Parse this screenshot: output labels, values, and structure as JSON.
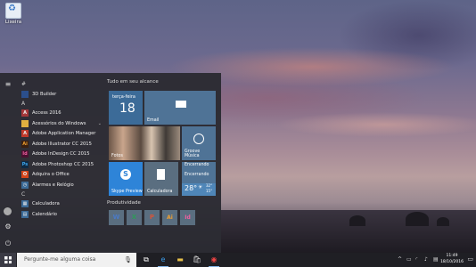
{
  "desktop": {
    "recycle_bin_label": "Lixeira"
  },
  "start_menu": {
    "rail": {
      "hamburger_icon": "hamburger-icon",
      "settings_icon": "gear-icon",
      "power_icon": "power-icon"
    },
    "sections": [
      {
        "letter": "#",
        "apps": [
          {
            "label": "3D Builder",
            "color": "#2b4f8c",
            "glyph": "3D"
          }
        ]
      },
      {
        "letter": "A",
        "apps": [
          {
            "label": "Access 2016",
            "color": "#a4373a",
            "glyph": "A"
          },
          {
            "label": "Acessórios do Windows",
            "color": "#e0b040",
            "glyph": "▬",
            "expand": "⌄"
          },
          {
            "label": "Adobe Application Manager",
            "color": "#c0392b",
            "glyph": "A"
          },
          {
            "label": "Adobe Illustrator CC 2015",
            "color": "#3a2010",
            "glyph": "Ai"
          },
          {
            "label": "Adobe InDesign CC 2015",
            "color": "#4a1030",
            "glyph": "Id"
          },
          {
            "label": "Adobe Photoshop CC 2015",
            "color": "#0f2a44",
            "glyph": "Ps"
          },
          {
            "label": "Adquira o Office",
            "color": "#d4451a",
            "glyph": "O"
          },
          {
            "label": "Alarmes e Relógio",
            "color": "#3c6b98",
            "glyph": "◷"
          }
        ]
      },
      {
        "letter": "C",
        "apps": [
          {
            "label": "Calculadora",
            "color": "#3c6b98",
            "glyph": "▦"
          },
          {
            "label": "Calendário",
            "color": "#3c6b98",
            "glyph": "▤"
          }
        ]
      }
    ],
    "tiles": {
      "group1_title": "Tudo em seu alcance",
      "calendar": {
        "day_name": "terça-feira",
        "day_number": "18"
      },
      "mail": {
        "label": "Email"
      },
      "photos": {
        "label": "Fotos"
      },
      "groove": {
        "label": "Groove Música"
      },
      "news": {
        "line1": "Encerrando",
        "line2": "Encerrando"
      },
      "skype": {
        "label": "Skype Preview"
      },
      "calculator": {
        "label": "Calculadora"
      },
      "weather": {
        "temp": "28°",
        "hi": "32°",
        "lo": "15°"
      },
      "group2_title": "Produtividade",
      "productivity": [
        {
          "glyph": "W",
          "color": "#2b579a"
        },
        {
          "glyph": "X",
          "color": "#217346"
        },
        {
          "glyph": "P",
          "color": "#b7472a"
        },
        {
          "glyph": "Ai",
          "color": "#3a2010"
        },
        {
          "glyph": "Id",
          "color": "#4a1030"
        }
      ]
    }
  },
  "taskbar": {
    "search_placeholder": "Pergunte-me alguma coisa",
    "clock_time": "11:49",
    "clock_date": "18/10/2016"
  }
}
